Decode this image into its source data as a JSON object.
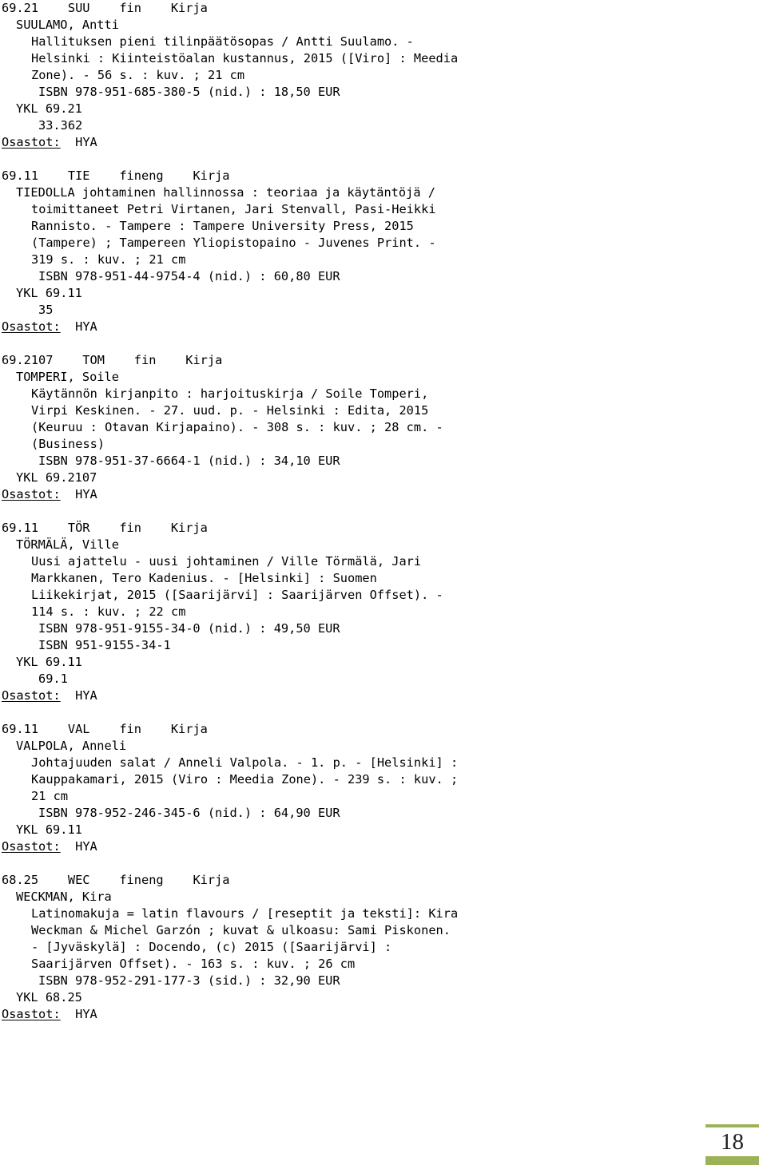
{
  "document": {
    "type": "library-acquisitions-list",
    "page_number": "18",
    "accent_color": "#9cb257",
    "text_color": "#000000",
    "background_color": "#ffffff"
  },
  "records": [
    {
      "header": "69.21    SUU    fin    Kirja",
      "lines": [
        {
          "indent": 1,
          "text": "SUULAMO, Antti"
        },
        {
          "indent": 2,
          "text": "Hallituksen pieni tilinpäätösopas / Antti Suulamo. -"
        },
        {
          "indent": 2,
          "text": "Helsinki : Kiinteistöalan kustannus, 2015 ([Viro] : Meedia"
        },
        {
          "indent": 2,
          "text": "Zone). - 56 s. : kuv. ; 21 cm"
        },
        {
          "indent": 3,
          "text": "ISBN 978-951-685-380-5 (nid.) : 18,50 EUR"
        },
        {
          "indent": 1,
          "text": "YKL 69.21"
        },
        {
          "indent": 3,
          "text": "33.362"
        }
      ],
      "osastot_label": "Osastot:",
      "osastot_value": "  HYA"
    },
    {
      "header": "69.11    TIE    fineng    Kirja",
      "lines": [
        {
          "indent": 1,
          "text": "TIEDOLLA johtaminen hallinnossa : teoriaa ja käytäntöjä /"
        },
        {
          "indent": 2,
          "text": "toimittaneet Petri Virtanen, Jari Stenvall, Pasi-Heikki"
        },
        {
          "indent": 2,
          "text": "Rannisto. - Tampere : Tampere University Press, 2015"
        },
        {
          "indent": 2,
          "text": "(Tampere) ; Tampereen Yliopistopaino - Juvenes Print. -"
        },
        {
          "indent": 2,
          "text": "319 s. : kuv. ; 21 cm"
        },
        {
          "indent": 3,
          "text": "ISBN 978-951-44-9754-4 (nid.) : 60,80 EUR"
        },
        {
          "indent": 1,
          "text": "YKL 69.11"
        },
        {
          "indent": 3,
          "text": "35"
        }
      ],
      "osastot_label": "Osastot:",
      "osastot_value": "  HYA"
    },
    {
      "header": "69.2107    TOM    fin    Kirja",
      "lines": [
        {
          "indent": 1,
          "text": "TOMPERI, Soile"
        },
        {
          "indent": 2,
          "text": "Käytännön kirjanpito : harjoituskirja / Soile Tomperi,"
        },
        {
          "indent": 2,
          "text": "Virpi Keskinen. - 27. uud. p. - Helsinki : Edita, 2015"
        },
        {
          "indent": 2,
          "text": "(Keuruu : Otavan Kirjapaino). - 308 s. : kuv. ; 28 cm. -"
        },
        {
          "indent": 2,
          "text": "(Business)"
        },
        {
          "indent": 3,
          "text": "ISBN 978-951-37-6664-1 (nid.) : 34,10 EUR"
        },
        {
          "indent": 1,
          "text": "YKL 69.2107"
        }
      ],
      "osastot_label": "Osastot:",
      "osastot_value": "  HYA"
    },
    {
      "header": "69.11    TÖR    fin    Kirja",
      "lines": [
        {
          "indent": 1,
          "text": "TÖRMÄLÄ, Ville"
        },
        {
          "indent": 2,
          "text": "Uusi ajattelu - uusi johtaminen / Ville Törmälä, Jari"
        },
        {
          "indent": 2,
          "text": "Markkanen, Tero Kadenius. - [Helsinki] : Suomen"
        },
        {
          "indent": 2,
          "text": "Liikekirjat, 2015 ([Saarijärvi] : Saarijärven Offset). -"
        },
        {
          "indent": 2,
          "text": "114 s. : kuv. ; 22 cm"
        },
        {
          "indent": 3,
          "text": "ISBN 978-951-9155-34-0 (nid.) : 49,50 EUR"
        },
        {
          "indent": 3,
          "text": "ISBN 951-9155-34-1"
        },
        {
          "indent": 1,
          "text": "YKL 69.11"
        },
        {
          "indent": 3,
          "text": "69.1"
        }
      ],
      "osastot_label": "Osastot:",
      "osastot_value": "  HYA"
    },
    {
      "header": "69.11    VAL    fin    Kirja",
      "lines": [
        {
          "indent": 1,
          "text": "VALPOLA, Anneli"
        },
        {
          "indent": 2,
          "text": "Johtajuuden salat / Anneli Valpola. - 1. p. - [Helsinki] :"
        },
        {
          "indent": 2,
          "text": "Kauppakamari, 2015 (Viro : Meedia Zone). - 239 s. : kuv. ;"
        },
        {
          "indent": 2,
          "text": "21 cm"
        },
        {
          "indent": 3,
          "text": "ISBN 978-952-246-345-6 (nid.) : 64,90 EUR"
        },
        {
          "indent": 1,
          "text": "YKL 69.11"
        }
      ],
      "osastot_label": "Osastot:",
      "osastot_value": "  HYA"
    },
    {
      "header": "68.25    WEC    fineng    Kirja",
      "lines": [
        {
          "indent": 1,
          "text": "WECKMAN, Kira"
        },
        {
          "indent": 2,
          "text": "Latinomakuja = latin flavours / [reseptit ja teksti]: Kira"
        },
        {
          "indent": 2,
          "text": "Weckman & Michel Garzón ; kuvat & ulkoasu: Sami Piskonen."
        },
        {
          "indent": 2,
          "text": "- [Jyväskylä] : Docendo, (c) 2015 ([Saarijärvi] :"
        },
        {
          "indent": 2,
          "text": "Saarijärven Offset). - 163 s. : kuv. ; 26 cm"
        },
        {
          "indent": 3,
          "text": "ISBN 978-952-291-177-3 (sid.) : 32,90 EUR"
        },
        {
          "indent": 1,
          "text": "YKL 68.25"
        }
      ],
      "osastot_label": "Osastot:",
      "osastot_value": "  HYA"
    }
  ]
}
